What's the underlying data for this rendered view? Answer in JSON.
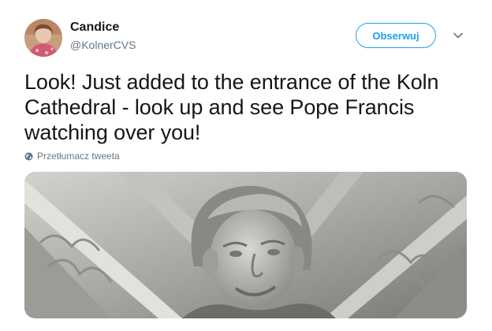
{
  "author": {
    "name": "Candice",
    "handle": "@KolnerCVS"
  },
  "actions": {
    "follow_label": "Obserwuj",
    "more_icon": "chevron-down-icon"
  },
  "tweet": {
    "text": "Look! Just added to the entrance of the Koln Cathedral - look up and see Pope Francis watching over you!",
    "translate_label": "Przetłumacz tweeta",
    "translate_icon": "globe-icon"
  },
  "colors": {
    "accent": "#1da1f2",
    "text": "#14171a",
    "muted": "#657786"
  }
}
